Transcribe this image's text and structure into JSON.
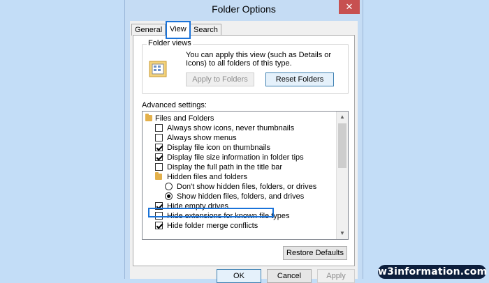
{
  "window": {
    "title": "Folder Options",
    "close_glyph": "✕"
  },
  "tabs": [
    {
      "label": "General",
      "active": false
    },
    {
      "label": "View",
      "active": true
    },
    {
      "label": "Search",
      "active": false
    }
  ],
  "folder_views": {
    "label": "Folder views",
    "description": "You can apply this view (such as Details or Icons) to all folders of this type.",
    "apply_button": "Apply to Folders",
    "reset_button": "Reset Folders",
    "icon": "folder-views-icon"
  },
  "advanced": {
    "label": "Advanced settings:",
    "items": [
      {
        "kind": "folder",
        "label": "Files and Folders",
        "level": 0
      },
      {
        "kind": "checkbox",
        "label": "Always show icons, never thumbnails",
        "checked": false,
        "level": 1
      },
      {
        "kind": "checkbox",
        "label": "Always show menus",
        "checked": false,
        "level": 1
      },
      {
        "kind": "checkbox",
        "label": "Display file icon on thumbnails",
        "checked": true,
        "level": 1
      },
      {
        "kind": "checkbox",
        "label": "Display file size information in folder tips",
        "checked": true,
        "level": 1
      },
      {
        "kind": "checkbox",
        "label": "Display the full path in the title bar",
        "checked": false,
        "level": 1
      },
      {
        "kind": "folder",
        "label": "Hidden files and folders",
        "level": 1
      },
      {
        "kind": "radio",
        "label": "Don't show hidden files, folders, or drives",
        "checked": false,
        "level": 2
      },
      {
        "kind": "radio",
        "label": "Show hidden files, folders, and drives",
        "checked": true,
        "level": 2
      },
      {
        "kind": "checkbox",
        "label": "Hide empty drives",
        "checked": true,
        "level": 1
      },
      {
        "kind": "checkbox",
        "label": "Hide extensions for known file types",
        "checked": false,
        "level": 1
      },
      {
        "kind": "checkbox",
        "label": "Hide folder merge conflicts",
        "checked": true,
        "level": 1
      }
    ],
    "restore_button": "Restore Defaults"
  },
  "footer": {
    "ok": "OK",
    "cancel": "Cancel",
    "apply": "Apply"
  },
  "watermark": "w3information.com",
  "colors": {
    "accent_highlight": "#1a73d9",
    "close_button": "#c75050",
    "window_frame": "#c5dcf4",
    "background": "#c3ddf7"
  }
}
